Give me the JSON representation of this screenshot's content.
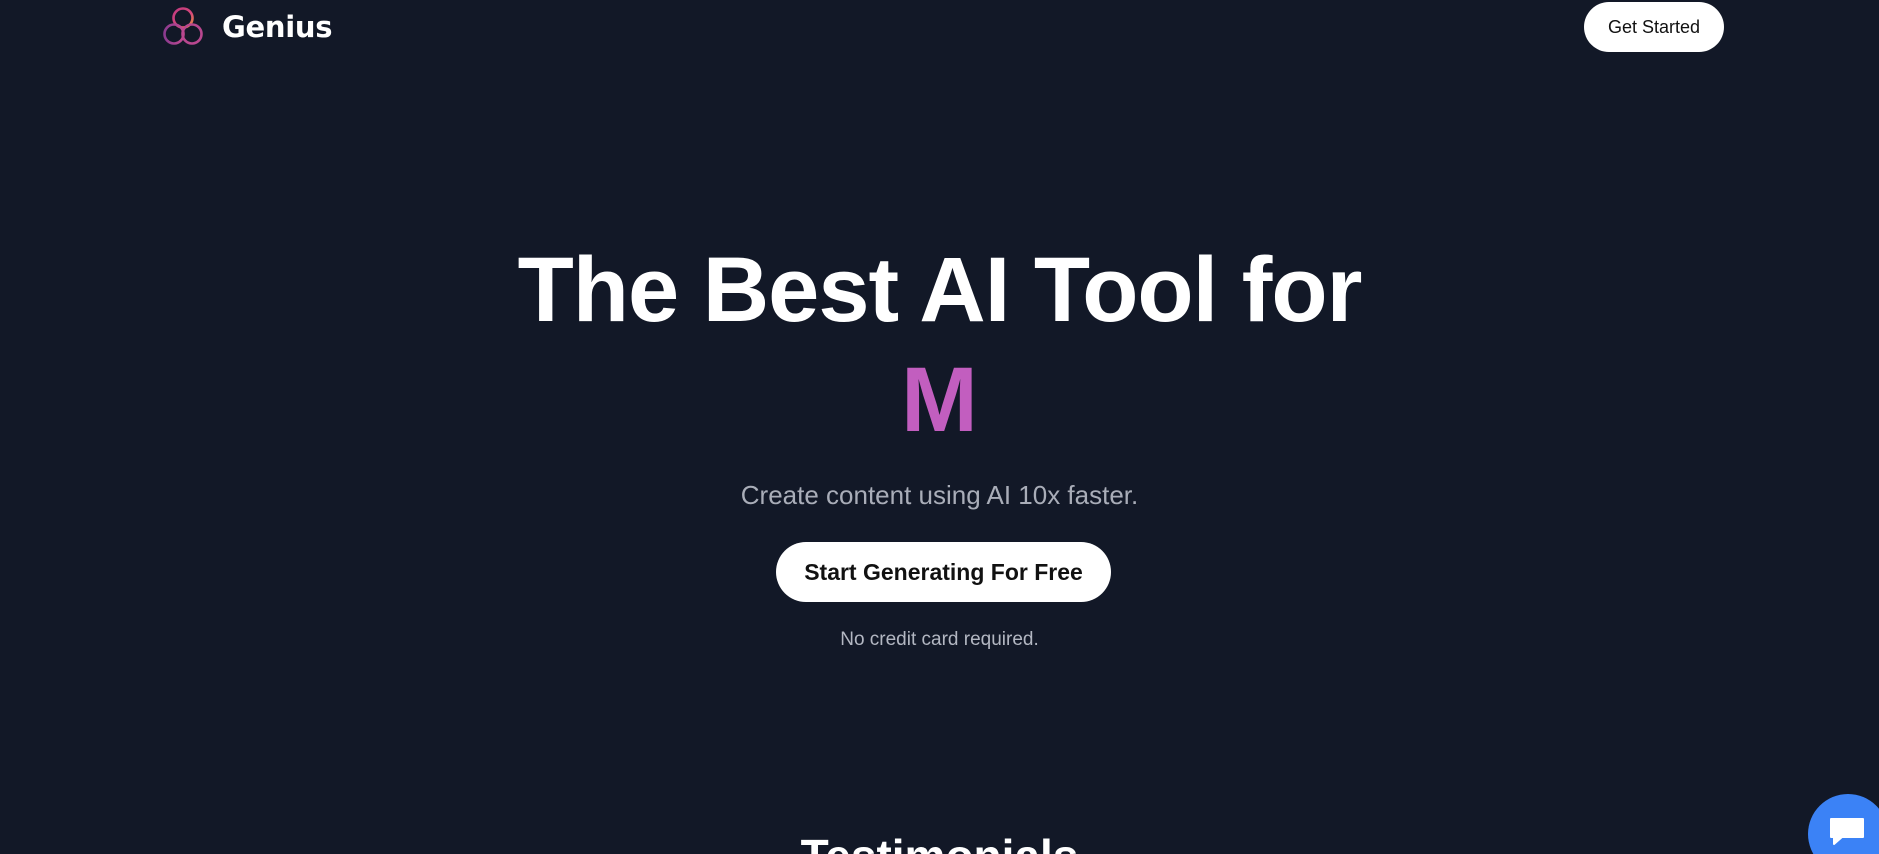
{
  "header": {
    "brand_name": "Genius",
    "logo_icon": "interlocking-rings-logo",
    "get_started_label": "Get Started"
  },
  "hero": {
    "headline": "The Best AI Tool for",
    "typed_text": "M",
    "subtitle": "Create content using AI 10x faster.",
    "cta_label": "Start Generating For Free",
    "note": "No credit card required."
  },
  "testimonials": {
    "title": "Testimonials"
  },
  "chat_widget": {
    "icon": "chat-bubble-icon"
  },
  "colors": {
    "background": "#121827",
    "accent": "#c25ebf",
    "chat_button": "#3b82f6",
    "button_bg": "#ffffff"
  }
}
